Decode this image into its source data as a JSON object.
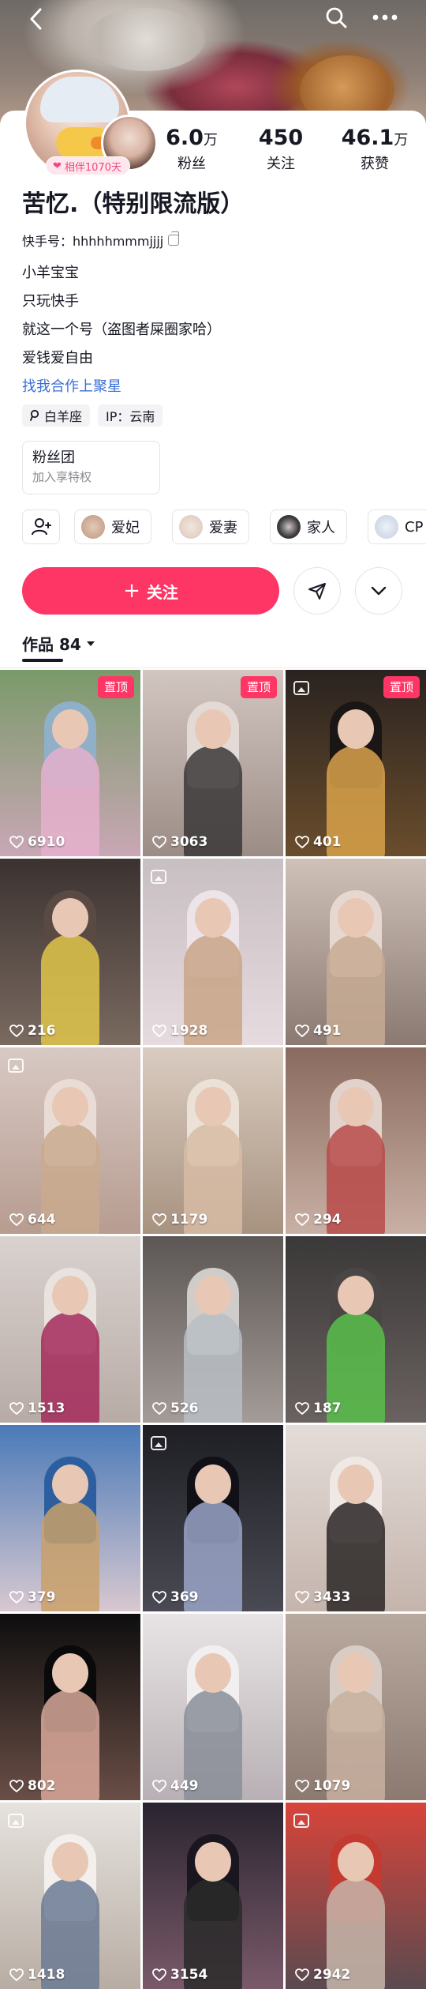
{
  "header": {
    "back_icon": "chevron-left-icon",
    "search_icon": "search-icon",
    "more_icon": "more-horizontal-icon"
  },
  "profile": {
    "companion_badge": "相伴1070天",
    "stats": [
      {
        "value": "6.0",
        "unit": "万",
        "label": "粉丝"
      },
      {
        "value": "450",
        "unit": "",
        "label": "关注"
      },
      {
        "value": "46.1",
        "unit": "万",
        "label": "获赞"
      }
    ],
    "name": "苦忆.（特别限流版）",
    "kuaishou_id": "快手号：hhhhhmmmjjjj",
    "bio_lines": [
      "小羊宝宝",
      "只玩快手",
      "就这一个号（盗图者屎圈家哈）",
      "爱钱爱自由"
    ],
    "bio_link": "找我合作上聚星",
    "tags": [
      {
        "icon": "location-pin-icon",
        "label": "白羊座"
      },
      {
        "icon": "",
        "label": "IP：云南"
      }
    ],
    "fan_club": {
      "title": "粉丝团",
      "subtitle": "加入享特权"
    },
    "friends": [
      {
        "label": "爱妃",
        "color": "#c9a590"
      },
      {
        "label": "爱妻",
        "color": "#e2cfc4"
      },
      {
        "label": "家人",
        "color": "#3a3a3a"
      },
      {
        "label": "CP",
        "color": "#cfd8e8"
      }
    ],
    "follow_label": "关注"
  },
  "works": {
    "tab_label": "作品 84",
    "pinned_label": "置顶",
    "items": [
      {
        "likes": "6910",
        "pinned": true,
        "album": false,
        "bg1": "#7a9a6a",
        "bg2": "#c9a7b5",
        "top": "#8fb0c8",
        "outfit": "#e5b0cc"
      },
      {
        "likes": "3063",
        "pinned": true,
        "album": false,
        "bg1": "#d2c6c0",
        "bg2": "#9c8c86",
        "top": "#e3dad6",
        "outfit": "#3b3838"
      },
      {
        "likes": "401",
        "pinned": true,
        "album": true,
        "bg1": "#2a2320",
        "bg2": "#6a4d2c",
        "top": "#1a1616",
        "outfit": "#d9a24a"
      },
      {
        "likes": "216",
        "pinned": false,
        "album": false,
        "bg1": "#3b3230",
        "bg2": "#7a6a60",
        "top": "#5a4a44",
        "outfit": "#e0c64a"
      },
      {
        "likes": "1928",
        "pinned": false,
        "album": true,
        "bg1": "#c8bfc2",
        "bg2": "#e6dbdf",
        "top": "#ece4e8",
        "outfit": "#c9a487"
      },
      {
        "likes": "491",
        "pinned": false,
        "album": false,
        "bg1": "#cfc0b8",
        "bg2": "#8a7a72",
        "top": "#e6d8d0",
        "outfit": "#c7ab93"
      },
      {
        "likes": "644",
        "pinned": false,
        "album": true,
        "bg1": "#d8c9c4",
        "bg2": "#b79c90",
        "top": "#e9dcd6",
        "outfit": "#c9aa8e"
      },
      {
        "likes": "1179",
        "pinned": false,
        "album": false,
        "bg1": "#d9ccc0",
        "bg2": "#a89280",
        "top": "#ebe1d7",
        "outfit": "#d7bca4"
      },
      {
        "likes": "294",
        "pinned": false,
        "album": false,
        "bg1": "#8a6a5e",
        "bg2": "#c9b0a4",
        "top": "#e1d3cc",
        "outfit": "#b84a4a"
      },
      {
        "likes": "1513",
        "pinned": false,
        "album": false,
        "bg1": "#d9d2cf",
        "bg2": "#b8aba6",
        "top": "#e9e3e0",
        "outfit": "#a52a5a"
      },
      {
        "likes": "526",
        "pinned": false,
        "album": false,
        "bg1": "#5c5654",
        "bg2": "#a49c98",
        "top": "#d0ccca",
        "outfit": "#b9bec4"
      },
      {
        "likes": "187",
        "pinned": false,
        "album": false,
        "bg1": "#3a3838",
        "bg2": "#6a6260",
        "top": "#4a4646",
        "outfit": "#58c04a"
      },
      {
        "likes": "379",
        "pinned": false,
        "album": false,
        "bg1": "#4a7ab8",
        "bg2": "#d8c8d0",
        "top": "#2d5fa0",
        "outfit": "#c9a06a"
      },
      {
        "likes": "369",
        "pinned": false,
        "album": true,
        "bg1": "#1e1e24",
        "bg2": "#4a4a54",
        "top": "#101016",
        "outfit": "#9aa4c8"
      },
      {
        "likes": "3433",
        "pinned": false,
        "album": false,
        "bg1": "#e4dcd8",
        "bg2": "#c4b4ac",
        "top": "#f0e8e4",
        "outfit": "#2a2626"
      },
      {
        "likes": "802",
        "pinned": false,
        "album": false,
        "bg1": "#0e0e0e",
        "bg2": "#6a4e46",
        "top": "#0a0a0a",
        "outfit": "#d8a89a"
      },
      {
        "likes": "449",
        "pinned": false,
        "album": false,
        "bg1": "#e8e4e6",
        "bg2": "#b8b0b4",
        "top": "#f2eff0",
        "outfit": "#8a8e98"
      },
      {
        "likes": "1079",
        "pinned": false,
        "album": false,
        "bg1": "#b9aaa0",
        "bg2": "#8c7a70",
        "top": "#d8ccc4",
        "outfit": "#c8b0a0"
      },
      {
        "likes": "1418",
        "pinned": false,
        "album": true,
        "bg1": "#e6e2de",
        "bg2": "#b8ada4",
        "top": "#f2efec",
        "outfit": "#6c7a94"
      },
      {
        "likes": "3154",
        "pinned": false,
        "album": false,
        "bg1": "#2a2430",
        "bg2": "#7a5a6a",
        "top": "#1a1620",
        "outfit": "#2a2a2a"
      },
      {
        "likes": "2942",
        "pinned": false,
        "album": true,
        "bg1": "#d8443a",
        "bg2": "#5a4a50",
        "top": "#c23a30",
        "outfit": "#c7b6aa"
      }
    ]
  }
}
